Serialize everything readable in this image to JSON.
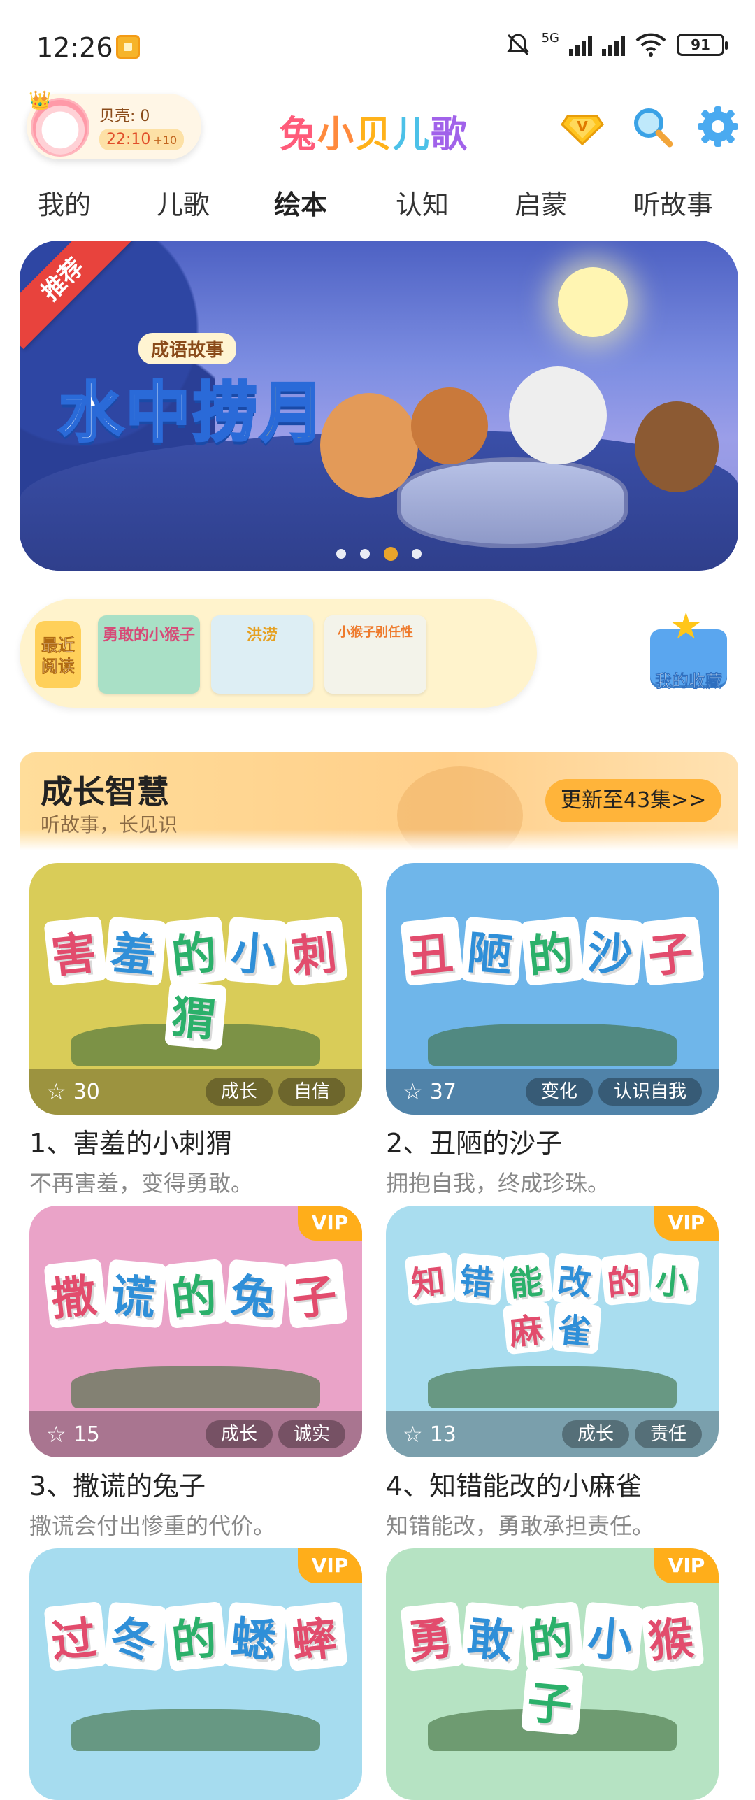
{
  "status": {
    "time": "12:26",
    "network": "5G",
    "battery": "91"
  },
  "header": {
    "shell_label": "贝壳: 0",
    "time_pill": "22:10",
    "time_bonus": "+10",
    "logo": [
      "兔",
      "小",
      "贝",
      "儿",
      "歌"
    ]
  },
  "tabs": [
    "我的",
    "儿歌",
    "绘本",
    "认知",
    "启蒙",
    "听故事"
  ],
  "banner": {
    "ribbon": "推荐",
    "subtitle": "成语故事",
    "title_a": "水中捞",
    "title_b": "月"
  },
  "recent": {
    "label_line1": "最近",
    "label_line2": "阅读",
    "thumbs": [
      "勇敢的小猴子",
      "洪涝",
      "小猴子别任性"
    ]
  },
  "favorites_label": "我的收藏",
  "section": {
    "title": "成长智慧",
    "subtitle": "听故事，长见识",
    "update_button": "更新至43集>>"
  },
  "cards": [
    {
      "art": [
        "害",
        "羞",
        "的",
        "小",
        "刺",
        "猬"
      ],
      "rating": "30",
      "tags": [
        "成长",
        "自信"
      ],
      "title": "1、害羞的小刺猬",
      "desc": "不再害羞，变得勇敢。",
      "vip": "",
      "bg": "#d9cc58"
    },
    {
      "art": [
        "丑",
        "陋",
        "的",
        "沙",
        "子"
      ],
      "rating": "37",
      "tags": [
        "变化",
        "认识自我"
      ],
      "title": "2、丑陋的沙子",
      "desc": "拥抱自我，终成珍珠。",
      "vip": "",
      "bg": "#6fb6ea"
    },
    {
      "art": [
        "撒",
        "谎",
        "的",
        "兔",
        "子"
      ],
      "rating": "15",
      "tags": [
        "成长",
        "诚实"
      ],
      "title": "3、撒谎的兔子",
      "desc": "撒谎会付出惨重的代价。",
      "vip": "VIP",
      "bg": "#eaa3c8"
    },
    {
      "art": [
        "知",
        "错",
        "能",
        "改",
        "的",
        "小",
        "麻",
        "雀"
      ],
      "rating": "13",
      "tags": [
        "成长",
        "责任"
      ],
      "title": "4、知错能改的小麻雀",
      "desc": "知错能改，勇敢承担责任。",
      "vip": "VIP",
      "bg": "#a9ddef"
    },
    {
      "art": [
        "过",
        "冬",
        "的",
        "蟋",
        "蟀"
      ],
      "rating": "",
      "tags": [],
      "title": "",
      "desc": "",
      "vip": "VIP",
      "bg": "#a6dcef"
    },
    {
      "art": [
        "勇",
        "敢",
        "的",
        "小",
        "猴",
        "子"
      ],
      "rating": "",
      "tags": [],
      "title": "",
      "desc": "",
      "vip": "VIP",
      "bg": "#b6e3c3"
    }
  ]
}
